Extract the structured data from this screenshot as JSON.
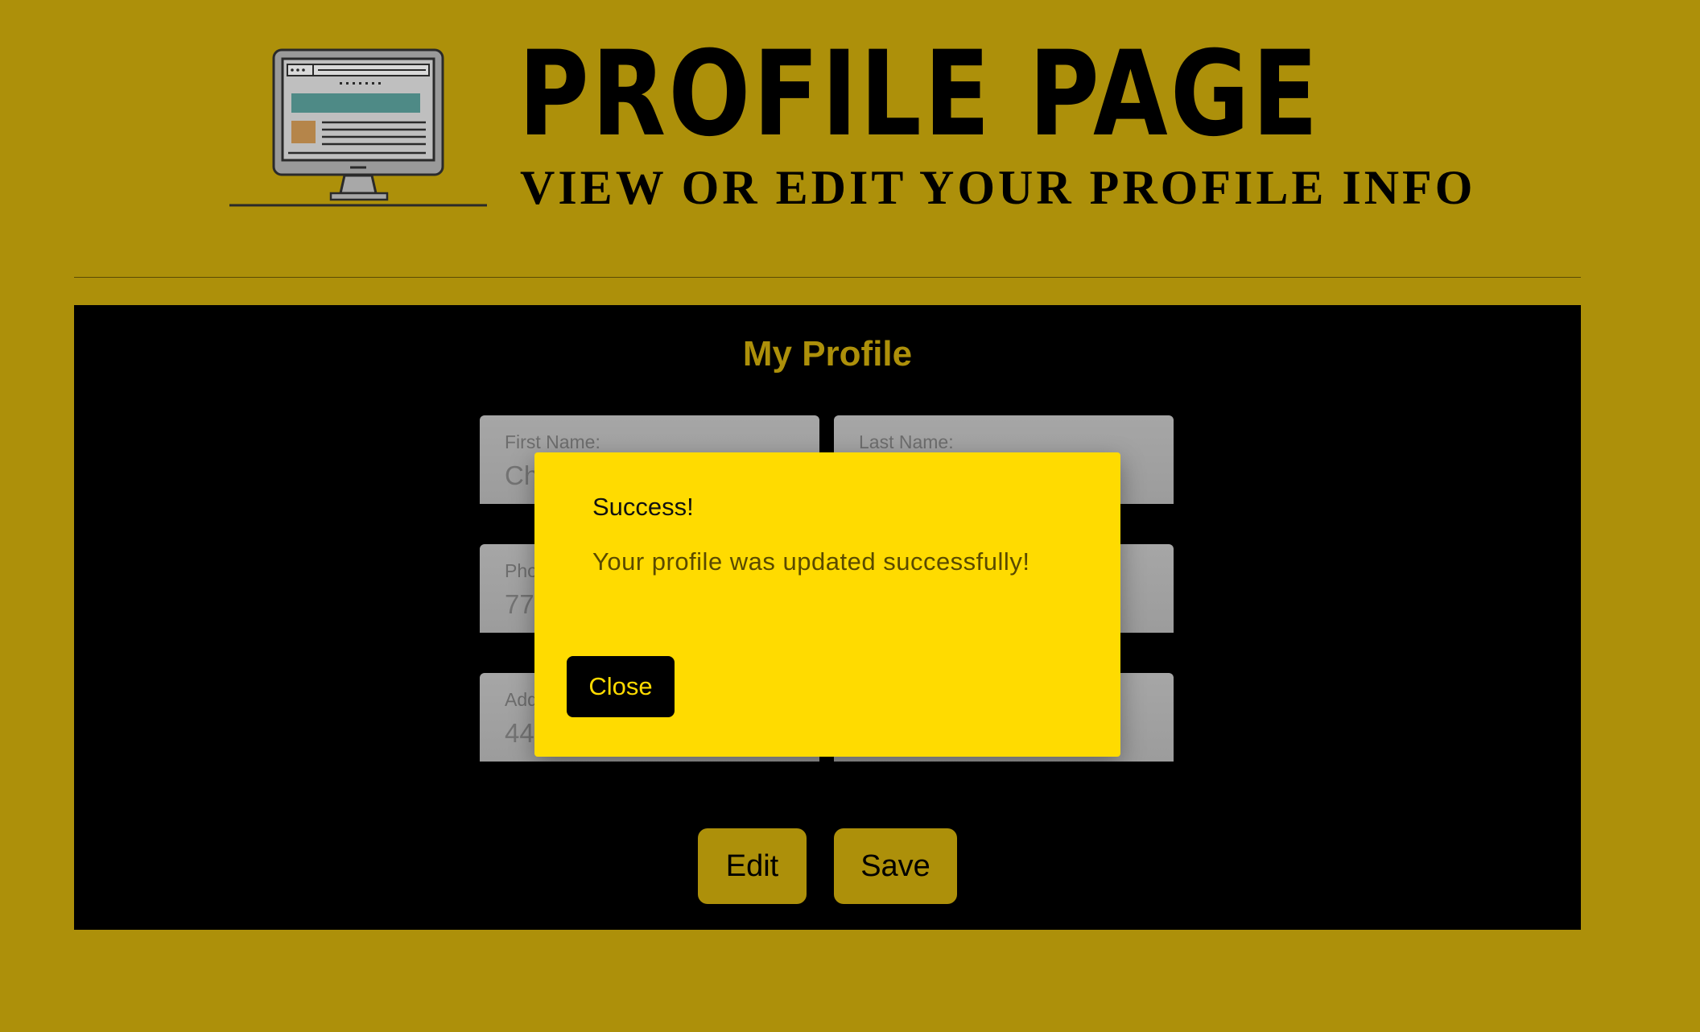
{
  "header": {
    "title": "PROFILE PAGE",
    "subtitle": "VIEW OR EDIT YOUR PROFILE INFO",
    "logo_icon": "desktop-monitor-icon"
  },
  "profile": {
    "heading": "My Profile",
    "fields": {
      "first_name": {
        "label": "First Name:",
        "value": "Ch"
      },
      "last_name": {
        "label": "Last Name:",
        "value": ""
      },
      "phone": {
        "label": "Pho",
        "value": "77"
      },
      "phone_right": {
        "label": "",
        "value": ""
      },
      "address": {
        "label": "Add",
        "value": "44"
      },
      "address_right": {
        "label": "",
        "value": ""
      }
    },
    "buttons": {
      "edit": "Edit",
      "save": "Save"
    }
  },
  "dialog": {
    "title": "Success!",
    "message": "Your profile was updated successfully!",
    "close_label": "Close"
  },
  "colors": {
    "background": "#ad900a",
    "panel": "#000000",
    "dialog": "#ffdb00",
    "accent": "#ad900a"
  }
}
